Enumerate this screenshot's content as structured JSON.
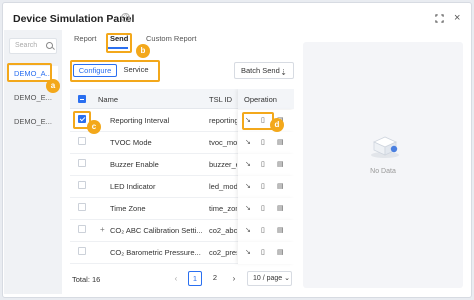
{
  "window": {
    "title": "Device Simulation Panel",
    "help": "?",
    "close": "×"
  },
  "sidebar": {
    "search_placeholder": "Search",
    "devices": [
      "DEMO_A...",
      "DEMO_E...",
      "DEMO_E..."
    ]
  },
  "tabs": [
    "Report",
    "Send",
    "Custom Report"
  ],
  "segment": {
    "configure": "Configure",
    "service": "Service"
  },
  "batch_send": {
    "label": "Batch Send",
    "icon": "⇣"
  },
  "table": {
    "headers": {
      "name": "Name",
      "tsl_id": "TSL ID",
      "operation": "Operation"
    },
    "rows": [
      {
        "name": "Reporting Interval",
        "tsl_id": "reporting_",
        "checked": true,
        "expandable": false
      },
      {
        "name": "TVOC Mode",
        "tsl_id": "tvoc_mod",
        "checked": false,
        "expandable": false
      },
      {
        "name": "Buzzer Enable",
        "tsl_id": "buzzer_e",
        "checked": false,
        "expandable": false
      },
      {
        "name": "LED Indicator",
        "tsl_id": "led_mode",
        "checked": false,
        "expandable": false
      },
      {
        "name": "Time Zone",
        "tsl_id": "time_zon",
        "checked": false,
        "expandable": false
      },
      {
        "name": "CO₂ ABC Calibration Setti...",
        "tsl_id": "co2_abc_",
        "checked": false,
        "expandable": true
      },
      {
        "name": "CO₂ Barometric Pressure...",
        "tsl_id": "co2_pres",
        "checked": false,
        "expandable": false
      }
    ],
    "plus": "+"
  },
  "pagination": {
    "total": "Total: 16",
    "prev": "‹",
    "pages": [
      "1",
      "2"
    ],
    "next": "›",
    "page_size": "10 / page ⌄"
  },
  "empty_state": {
    "text": "No Data"
  },
  "annotations": [
    "a",
    "b",
    "c",
    "d"
  ],
  "colors": {
    "accent": "#2a6ff0",
    "highlight": "#f3a81b"
  }
}
